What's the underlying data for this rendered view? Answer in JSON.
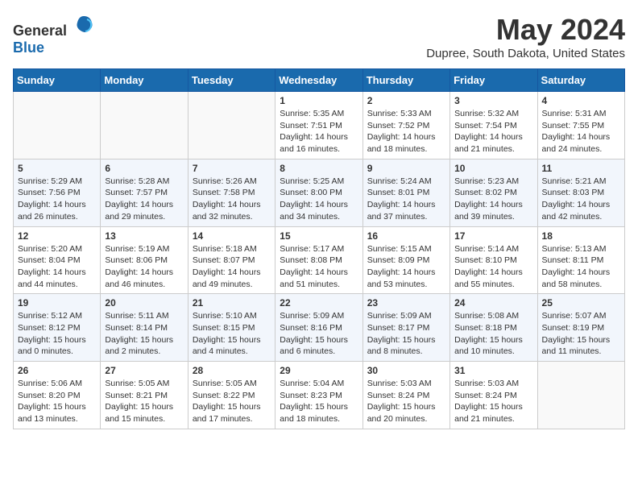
{
  "header": {
    "logo_general": "General",
    "logo_blue": "Blue",
    "title": "May 2024",
    "location": "Dupree, South Dakota, United States"
  },
  "weekdays": [
    "Sunday",
    "Monday",
    "Tuesday",
    "Wednesday",
    "Thursday",
    "Friday",
    "Saturday"
  ],
  "weeks": [
    [
      {
        "day": "",
        "info": ""
      },
      {
        "day": "",
        "info": ""
      },
      {
        "day": "",
        "info": ""
      },
      {
        "day": "1",
        "info": "Sunrise: 5:35 AM\nSunset: 7:51 PM\nDaylight: 14 hours\nand 16 minutes."
      },
      {
        "day": "2",
        "info": "Sunrise: 5:33 AM\nSunset: 7:52 PM\nDaylight: 14 hours\nand 18 minutes."
      },
      {
        "day": "3",
        "info": "Sunrise: 5:32 AM\nSunset: 7:54 PM\nDaylight: 14 hours\nand 21 minutes."
      },
      {
        "day": "4",
        "info": "Sunrise: 5:31 AM\nSunset: 7:55 PM\nDaylight: 14 hours\nand 24 minutes."
      }
    ],
    [
      {
        "day": "5",
        "info": "Sunrise: 5:29 AM\nSunset: 7:56 PM\nDaylight: 14 hours\nand 26 minutes."
      },
      {
        "day": "6",
        "info": "Sunrise: 5:28 AM\nSunset: 7:57 PM\nDaylight: 14 hours\nand 29 minutes."
      },
      {
        "day": "7",
        "info": "Sunrise: 5:26 AM\nSunset: 7:58 PM\nDaylight: 14 hours\nand 32 minutes."
      },
      {
        "day": "8",
        "info": "Sunrise: 5:25 AM\nSunset: 8:00 PM\nDaylight: 14 hours\nand 34 minutes."
      },
      {
        "day": "9",
        "info": "Sunrise: 5:24 AM\nSunset: 8:01 PM\nDaylight: 14 hours\nand 37 minutes."
      },
      {
        "day": "10",
        "info": "Sunrise: 5:23 AM\nSunset: 8:02 PM\nDaylight: 14 hours\nand 39 minutes."
      },
      {
        "day": "11",
        "info": "Sunrise: 5:21 AM\nSunset: 8:03 PM\nDaylight: 14 hours\nand 42 minutes."
      }
    ],
    [
      {
        "day": "12",
        "info": "Sunrise: 5:20 AM\nSunset: 8:04 PM\nDaylight: 14 hours\nand 44 minutes."
      },
      {
        "day": "13",
        "info": "Sunrise: 5:19 AM\nSunset: 8:06 PM\nDaylight: 14 hours\nand 46 minutes."
      },
      {
        "day": "14",
        "info": "Sunrise: 5:18 AM\nSunset: 8:07 PM\nDaylight: 14 hours\nand 49 minutes."
      },
      {
        "day": "15",
        "info": "Sunrise: 5:17 AM\nSunset: 8:08 PM\nDaylight: 14 hours\nand 51 minutes."
      },
      {
        "day": "16",
        "info": "Sunrise: 5:15 AM\nSunset: 8:09 PM\nDaylight: 14 hours\nand 53 minutes."
      },
      {
        "day": "17",
        "info": "Sunrise: 5:14 AM\nSunset: 8:10 PM\nDaylight: 14 hours\nand 55 minutes."
      },
      {
        "day": "18",
        "info": "Sunrise: 5:13 AM\nSunset: 8:11 PM\nDaylight: 14 hours\nand 58 minutes."
      }
    ],
    [
      {
        "day": "19",
        "info": "Sunrise: 5:12 AM\nSunset: 8:12 PM\nDaylight: 15 hours\nand 0 minutes."
      },
      {
        "day": "20",
        "info": "Sunrise: 5:11 AM\nSunset: 8:14 PM\nDaylight: 15 hours\nand 2 minutes."
      },
      {
        "day": "21",
        "info": "Sunrise: 5:10 AM\nSunset: 8:15 PM\nDaylight: 15 hours\nand 4 minutes."
      },
      {
        "day": "22",
        "info": "Sunrise: 5:09 AM\nSunset: 8:16 PM\nDaylight: 15 hours\nand 6 minutes."
      },
      {
        "day": "23",
        "info": "Sunrise: 5:09 AM\nSunset: 8:17 PM\nDaylight: 15 hours\nand 8 minutes."
      },
      {
        "day": "24",
        "info": "Sunrise: 5:08 AM\nSunset: 8:18 PM\nDaylight: 15 hours\nand 10 minutes."
      },
      {
        "day": "25",
        "info": "Sunrise: 5:07 AM\nSunset: 8:19 PM\nDaylight: 15 hours\nand 11 minutes."
      }
    ],
    [
      {
        "day": "26",
        "info": "Sunrise: 5:06 AM\nSunset: 8:20 PM\nDaylight: 15 hours\nand 13 minutes."
      },
      {
        "day": "27",
        "info": "Sunrise: 5:05 AM\nSunset: 8:21 PM\nDaylight: 15 hours\nand 15 minutes."
      },
      {
        "day": "28",
        "info": "Sunrise: 5:05 AM\nSunset: 8:22 PM\nDaylight: 15 hours\nand 17 minutes."
      },
      {
        "day": "29",
        "info": "Sunrise: 5:04 AM\nSunset: 8:23 PM\nDaylight: 15 hours\nand 18 minutes."
      },
      {
        "day": "30",
        "info": "Sunrise: 5:03 AM\nSunset: 8:24 PM\nDaylight: 15 hours\nand 20 minutes."
      },
      {
        "day": "31",
        "info": "Sunrise: 5:03 AM\nSunset: 8:24 PM\nDaylight: 15 hours\nand 21 minutes."
      },
      {
        "day": "",
        "info": ""
      }
    ]
  ]
}
